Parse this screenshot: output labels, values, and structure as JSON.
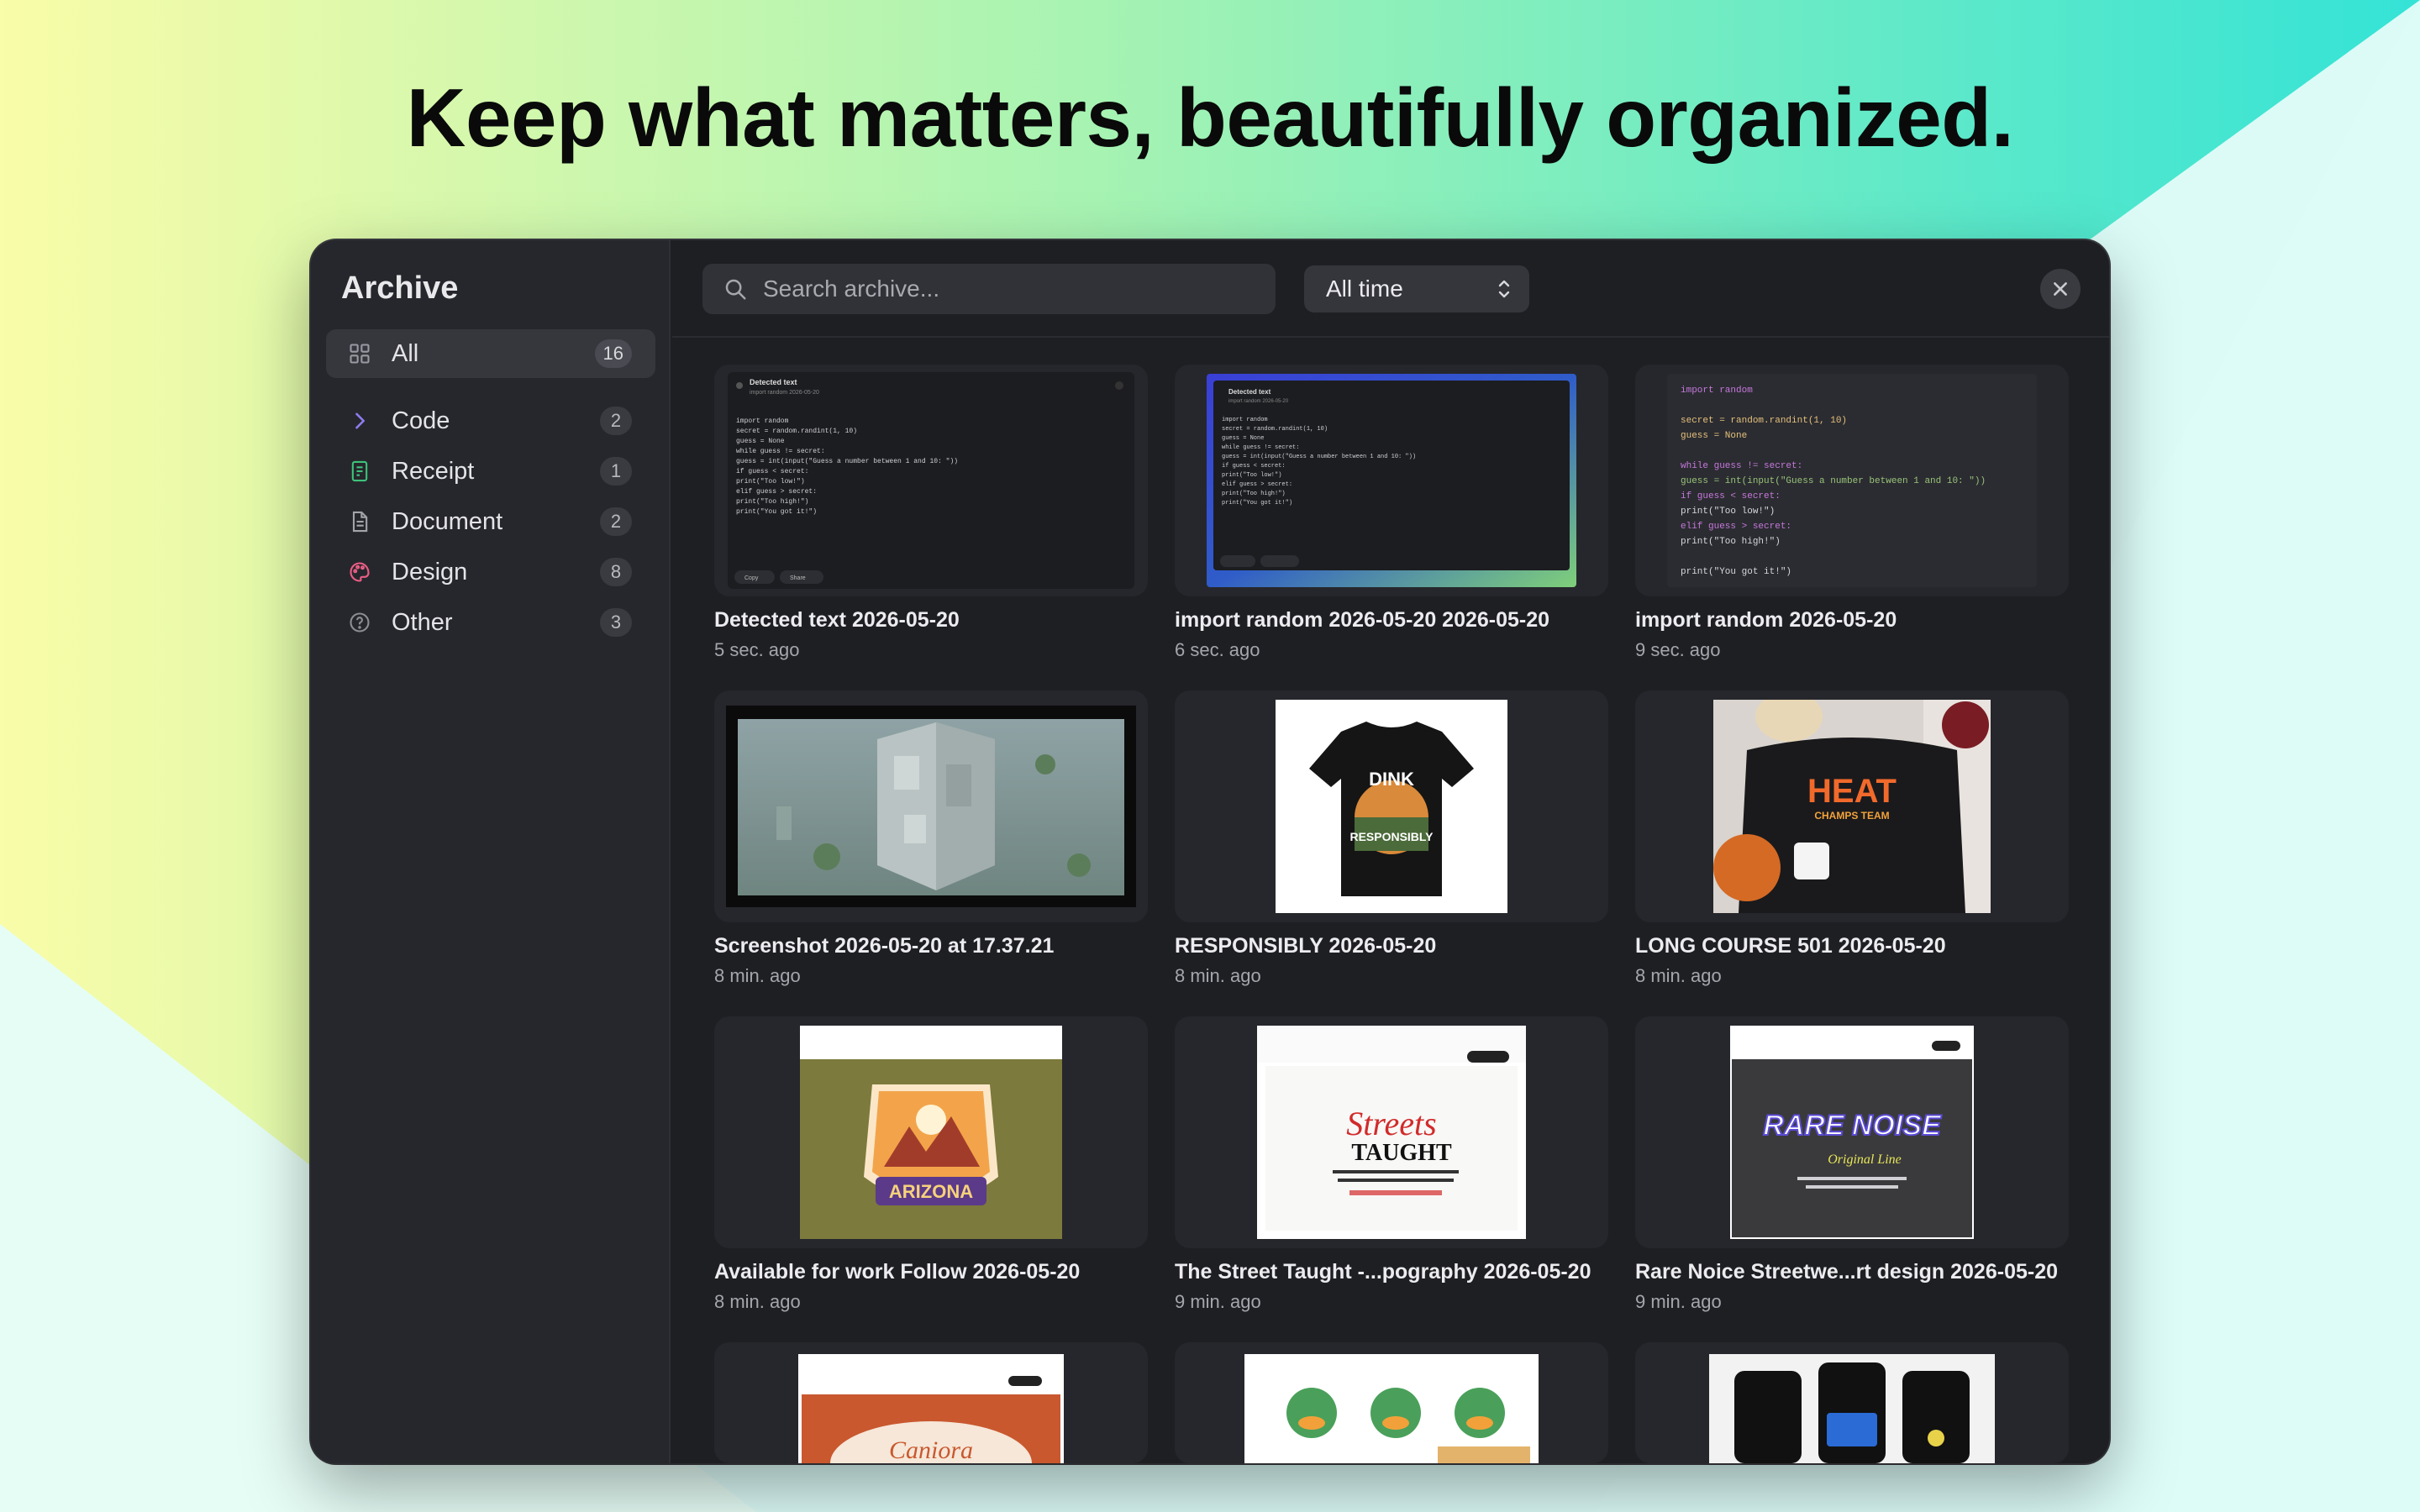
{
  "headline": "Keep what matters, beautifully organized.",
  "colors": {
    "bg_top_left": "#f9fca8",
    "bg_green": "#9ef2b8",
    "bg_teal": "#3fe6d4",
    "bg_light": "#dffcf6",
    "window_bg": "#1e1f23",
    "sidebar_bg": "#26272c"
  },
  "sidebar": {
    "title": "Archive",
    "items": [
      {
        "label": "All",
        "count": "16",
        "icon": "grid-icon",
        "active": true
      },
      {
        "label": "Code",
        "count": "2",
        "icon": "chevron-right-icon"
      },
      {
        "label": "Receipt",
        "count": "1",
        "icon": "receipt-icon"
      },
      {
        "label": "Document",
        "count": "2",
        "icon": "document-icon"
      },
      {
        "label": "Design",
        "count": "8",
        "icon": "palette-icon"
      },
      {
        "label": "Other",
        "count": "3",
        "icon": "question-circle-icon"
      }
    ]
  },
  "toolbar": {
    "search_placeholder": "Search archive...",
    "filter_value": "All time"
  },
  "cards": [
    {
      "name": "Detected text 2026-05-20",
      "time": "5 sec. ago"
    },
    {
      "name": "import random 2026-05-20 2026-05-20",
      "time": "6 sec. ago"
    },
    {
      "name": "import random 2026-05-20",
      "time": "9 sec. ago"
    },
    {
      "name": "Screenshot 2026-05-20 at 17.37.21",
      "time": "8 min. ago"
    },
    {
      "name": "RESPONSIBLY 2026-05-20",
      "time": "8 min. ago"
    },
    {
      "name": "LONG COURSE 501 2026-05-20",
      "time": "8 min. ago"
    },
    {
      "name": "Available for work Follow 2026-05-20",
      "time": "8 min. ago"
    },
    {
      "name": "The Street Taught -...pography 2026-05-20",
      "time": "9 min. ago"
    },
    {
      "name": "Rare Noice Streetwe...rt design 2026-05-20",
      "time": "9 min. ago"
    }
  ],
  "thumbs": {
    "detected_title": "Detected text",
    "detected_sub": "import random 2026-05-20",
    "copy": "Copy",
    "share": "Share",
    "code_lines": [
      "import random",
      "secret = random.randint(1, 10)",
      "guess = None",
      "while guess != secret:",
      "    guess = int(input(\"Guess a number between 1 and 10: \"))",
      "    if guess < secret:",
      "        print(\"Too low!\")",
      "    elif guess > secret:",
      "        print(\"Too high!\")",
      "print(\"You got it!\")"
    ],
    "dink_top": "DINK",
    "dink_bottom": "RESPONSIBLY",
    "heat": "HEAT",
    "heat_sub": "CHAMPS TEAM",
    "arizona": "ARIZONA",
    "street_1": "Streets",
    "street_2": "TAUGHT",
    "rare": "RARE NOISE",
    "rare_sub": "Original Line",
    "caniora": "Caniora"
  }
}
